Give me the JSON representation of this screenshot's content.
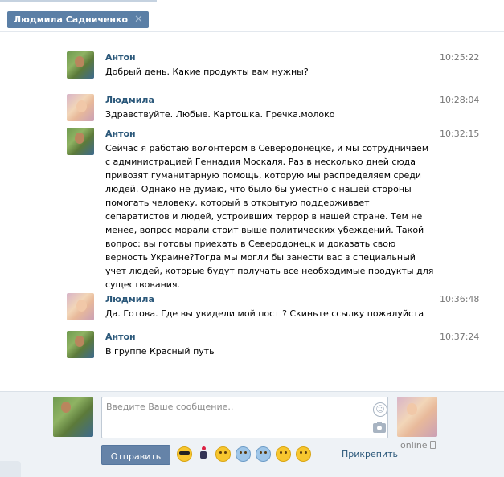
{
  "tab": {
    "title": "Людмила Садниченко"
  },
  "messages": [
    {
      "author": "Антон",
      "time": "10:25:22",
      "avatar": "anton",
      "lines": [
        "Добрый день. Какие продукты вам нужны?"
      ]
    },
    {
      "author": "Людмила",
      "time": "10:28:04",
      "avatar": "ludmila",
      "lines": [
        "Здравствуйте. Любые. Картошка. Гречка.молоко"
      ]
    },
    {
      "author": "Антон",
      "time": "10:32:15",
      "avatar": "anton",
      "lines": [
        "Сейчас я работаю волонтером в Северодонецке, и мы сотрудничаем",
        "с администрацией Геннадия Москаля. Раз в несколько дней сюда",
        "привозят гуманитарную помощь, которую мы распределяем среди",
        "людей. Однако не думаю, что было бы уместно с нашей стороны",
        "помогать человеку, который в открытую поддерживает",
        "сепаратистов и людей, устроивших террор в нашей стране. Тем не",
        "менее, вопрос морали стоит выше политических убеждений. Такой",
        "вопрос: вы готовы приехать в Северодонецк и доказать свою",
        "верность Украине?Тогда мы могли бы занести вас в специальный",
        "учет людей, которые будут получать все необходимые продукты для",
        "существования."
      ]
    },
    {
      "author": "Людмила",
      "time": "10:36:48",
      "avatar": "ludmila",
      "lines": [
        "Да. Готова. Где вы увидели мой пост ? Скиньте ссылку пожалуйста"
      ]
    },
    {
      "author": "Антон",
      "time": "10:37:24",
      "avatar": "anton",
      "lines": [
        "В группе Красный путь"
      ]
    }
  ],
  "composer": {
    "placeholder": "Введите Ваше сообщение..",
    "send_label": "Отправить",
    "attach_label": "Прикрепить",
    "status": "online",
    "emoji_icons": [
      "sunglasses-emoji-icon",
      "running-man-emoji-icon",
      "grinning-emoji-icon",
      "cold-sweat-emoji-icon",
      "screaming-emoji-icon",
      "astonished-emoji-icon",
      "no-mouth-emoji-icon"
    ]
  },
  "colors": {
    "accent": "#5b7fa6",
    "link": "#2b587a",
    "button": "#6583a8",
    "composer_bg": "#eef2f6"
  }
}
